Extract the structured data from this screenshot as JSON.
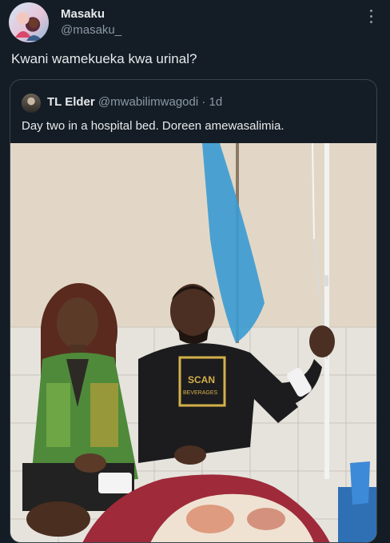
{
  "post": {
    "author_name": "Masaku",
    "author_handle": "@masaku_",
    "text": "Kwani wamekueka kwa urinal?"
  },
  "quoted_post": {
    "author_name": "TL Elder",
    "author_handle": "@mwabilimwagodi",
    "time": "· 1d",
    "text": "Day two in a hospital bed. Doreen amewasalimia."
  },
  "photo": {
    "shirt_print_line1": "SCAN",
    "shirt_print_line2": "BEVERAGES"
  },
  "icons": {
    "more": "more-vertical-icon"
  },
  "colors": {
    "background": "#141d26",
    "secondary_text": "#8b98a5",
    "border": "#38444d"
  }
}
